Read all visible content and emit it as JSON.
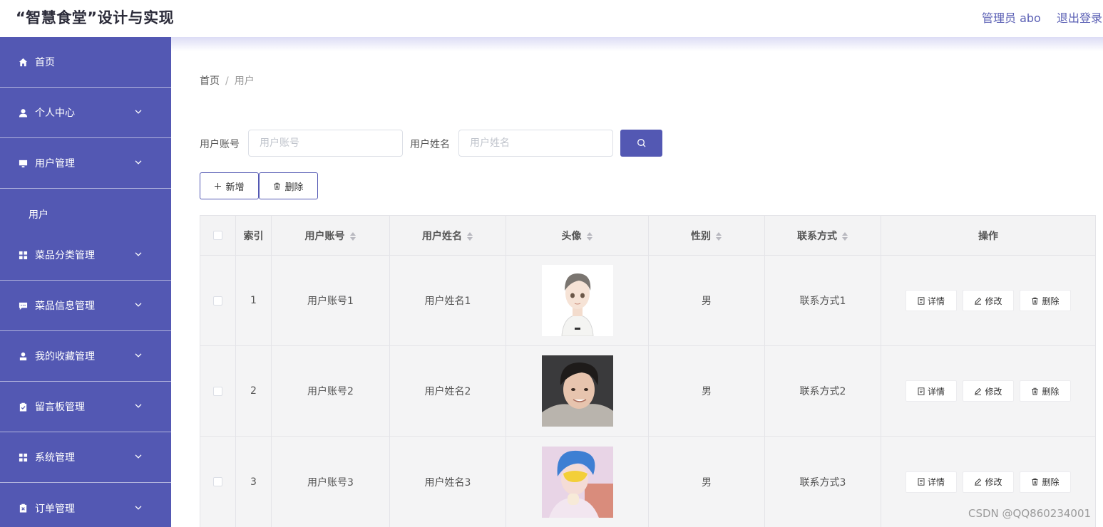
{
  "header": {
    "title": "“智慧食堂”设计与实现",
    "admin_label": "管理员 abo",
    "logout_label": "退出登录"
  },
  "sidebar": {
    "items": [
      {
        "label": "首页",
        "icon": "home-icon"
      },
      {
        "label": "个人中心",
        "icon": "user-icon"
      },
      {
        "label": "用户管理",
        "icon": "monitor-icon"
      },
      {
        "label": "菜品分类管理",
        "icon": "grid-icon"
      },
      {
        "label": "菜品信息管理",
        "icon": "message-icon"
      },
      {
        "label": "我的收藏管理",
        "icon": "user-solid-icon"
      },
      {
        "label": "留言板管理",
        "icon": "clipboard-icon"
      },
      {
        "label": "系统管理",
        "icon": "grid-icon"
      },
      {
        "label": "订单管理",
        "icon": "document-icon"
      }
    ],
    "sub_item": "用户"
  },
  "breadcrumb": {
    "home": "首页",
    "separator": "/",
    "current": "用户"
  },
  "search": {
    "account_label": "用户账号",
    "account_placeholder": "用户账号",
    "name_label": "用户姓名",
    "name_placeholder": "用户姓名"
  },
  "actions": {
    "add_label": "新增",
    "delete_label": "删除"
  },
  "table": {
    "headers": {
      "index": "索引",
      "account": "用户账号",
      "name": "用户姓名",
      "avatar": "头像",
      "gender": "性别",
      "contact": "联系方式",
      "ops": "操作"
    },
    "rows": [
      {
        "index": "1",
        "account": "用户账号1",
        "name": "用户姓名1",
        "gender": "男",
        "contact": "联系方式1"
      },
      {
        "index": "2",
        "account": "用户账号2",
        "name": "用户姓名2",
        "gender": "男",
        "contact": "联系方式2"
      },
      {
        "index": "3",
        "account": "用户账号3",
        "name": "用户姓名3",
        "gender": "男",
        "contact": "联系方式3"
      }
    ],
    "op_labels": {
      "detail": "详情",
      "edit": "修改",
      "delete": "删除"
    }
  },
  "watermark": "CSDN @QQ860234001",
  "colors": {
    "primary": "#5358b3",
    "header_text": "#5a5fb4",
    "table_bg": "#f4f4f5"
  }
}
